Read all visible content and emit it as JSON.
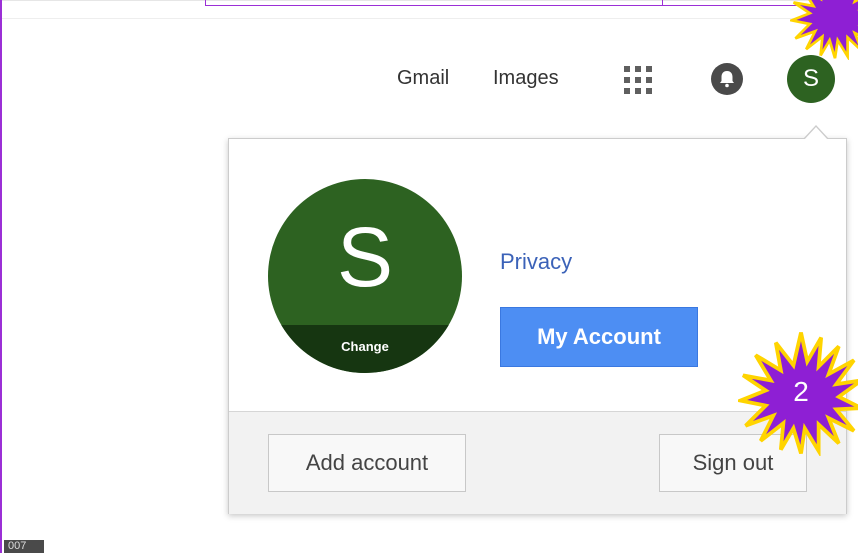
{
  "topbar": {
    "gmail": "Gmail",
    "images": "Images",
    "avatar_letter": "S"
  },
  "popup": {
    "avatar_letter": "S",
    "change_label": "Change",
    "privacy": "Privacy",
    "my_account": "My Account",
    "add_account": "Add account",
    "sign_out": "Sign out"
  },
  "badges": {
    "step_2": "2",
    "bottom_tag": "007"
  },
  "colors": {
    "avatar": "#2d6221",
    "primary_button": "#4d8ef3",
    "link": "#3b62b8",
    "highlight": "#9b2fd6"
  }
}
